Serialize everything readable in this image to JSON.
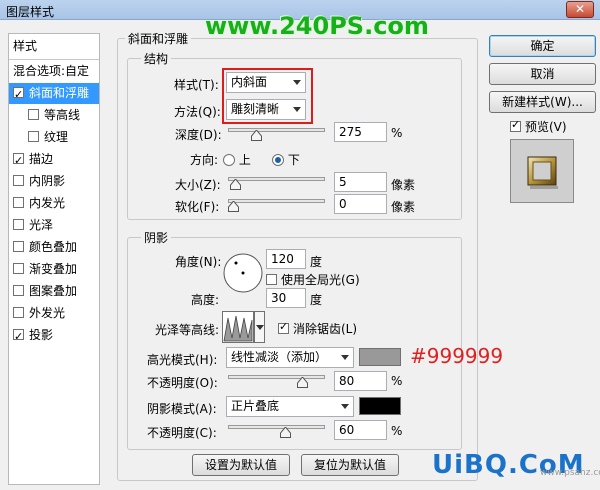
{
  "window": {
    "title": "图层样式",
    "close_label": "✕"
  },
  "watermark_top": "www.240PS.com",
  "left": {
    "header": "样式",
    "blend_options": "混合选项:自定",
    "items": [
      {
        "label": "斜面和浮雕",
        "checked": true,
        "selected": true,
        "sub": false
      },
      {
        "label": "等高线",
        "checked": false,
        "selected": false,
        "sub": true
      },
      {
        "label": "纹理",
        "checked": false,
        "selected": false,
        "sub": true
      },
      {
        "label": "描边",
        "checked": true,
        "selected": false,
        "sub": false
      },
      {
        "label": "内阴影",
        "checked": false,
        "selected": false,
        "sub": false
      },
      {
        "label": "内发光",
        "checked": false,
        "selected": false,
        "sub": false
      },
      {
        "label": "光泽",
        "checked": false,
        "selected": false,
        "sub": false
      },
      {
        "label": "颜色叠加",
        "checked": false,
        "selected": false,
        "sub": false
      },
      {
        "label": "渐变叠加",
        "checked": false,
        "selected": false,
        "sub": false
      },
      {
        "label": "图案叠加",
        "checked": false,
        "selected": false,
        "sub": false
      },
      {
        "label": "外发光",
        "checked": false,
        "selected": false,
        "sub": false
      },
      {
        "label": "投影",
        "checked": true,
        "selected": false,
        "sub": false
      }
    ]
  },
  "bevel": {
    "group_title": "斜面和浮雕",
    "structure_title": "结构",
    "style_label": "样式(T):",
    "style_value": "内斜面",
    "technique_label": "方法(Q):",
    "technique_value": "雕刻清晰",
    "depth_label": "深度(D):",
    "depth_value": "275",
    "depth_unit": "%",
    "depth_fraction": 0.27,
    "direction_label": "方向:",
    "direction_up": "上",
    "direction_down": "下",
    "direction_selected": "下",
    "size_label": "大小(Z):",
    "size_value": "5",
    "size_unit": "像素",
    "size_fraction": 0.02,
    "soften_label": "软化(F):",
    "soften_value": "0",
    "soften_unit": "像素",
    "soften_fraction": 0.0
  },
  "shading": {
    "title": "阴影",
    "angle_label": "角度(N):",
    "angle_value": "120",
    "angle_unit": "度",
    "global_light_label": "使用全局光(G)",
    "global_light_checked": false,
    "altitude_label": "高度:",
    "altitude_value": "30",
    "altitude_unit": "度",
    "gloss_label": "光泽等高线:",
    "antialias_label": "消除锯齿(L)",
    "antialias_checked": true,
    "highlight_mode_label": "高光模式(H):",
    "highlight_mode_value": "线性减淡（添加）",
    "highlight_color": "#999999",
    "highlight_opacity_label": "不透明度(O):",
    "highlight_opacity_value": "80",
    "highlight_opacity_unit": "%",
    "highlight_opacity_fraction": 0.8,
    "shadow_mode_label": "阴影模式(A):",
    "shadow_mode_value": "正片叠底",
    "shadow_color": "#000000",
    "shadow_opacity_label": "不透明度(C):",
    "shadow_opacity_value": "60",
    "shadow_opacity_unit": "%",
    "shadow_opacity_fraction": 0.6
  },
  "hex_note": "#999999",
  "buttons": {
    "ok": "确定",
    "cancel": "取消",
    "new_style": "新建样式(W)...",
    "preview": "预览(V)",
    "preview_checked": true,
    "make_default": "设置为默认值",
    "reset_default": "复位为默认值"
  },
  "logo": "UiBQ.CoM",
  "logo_small": "www.psahz.com"
}
